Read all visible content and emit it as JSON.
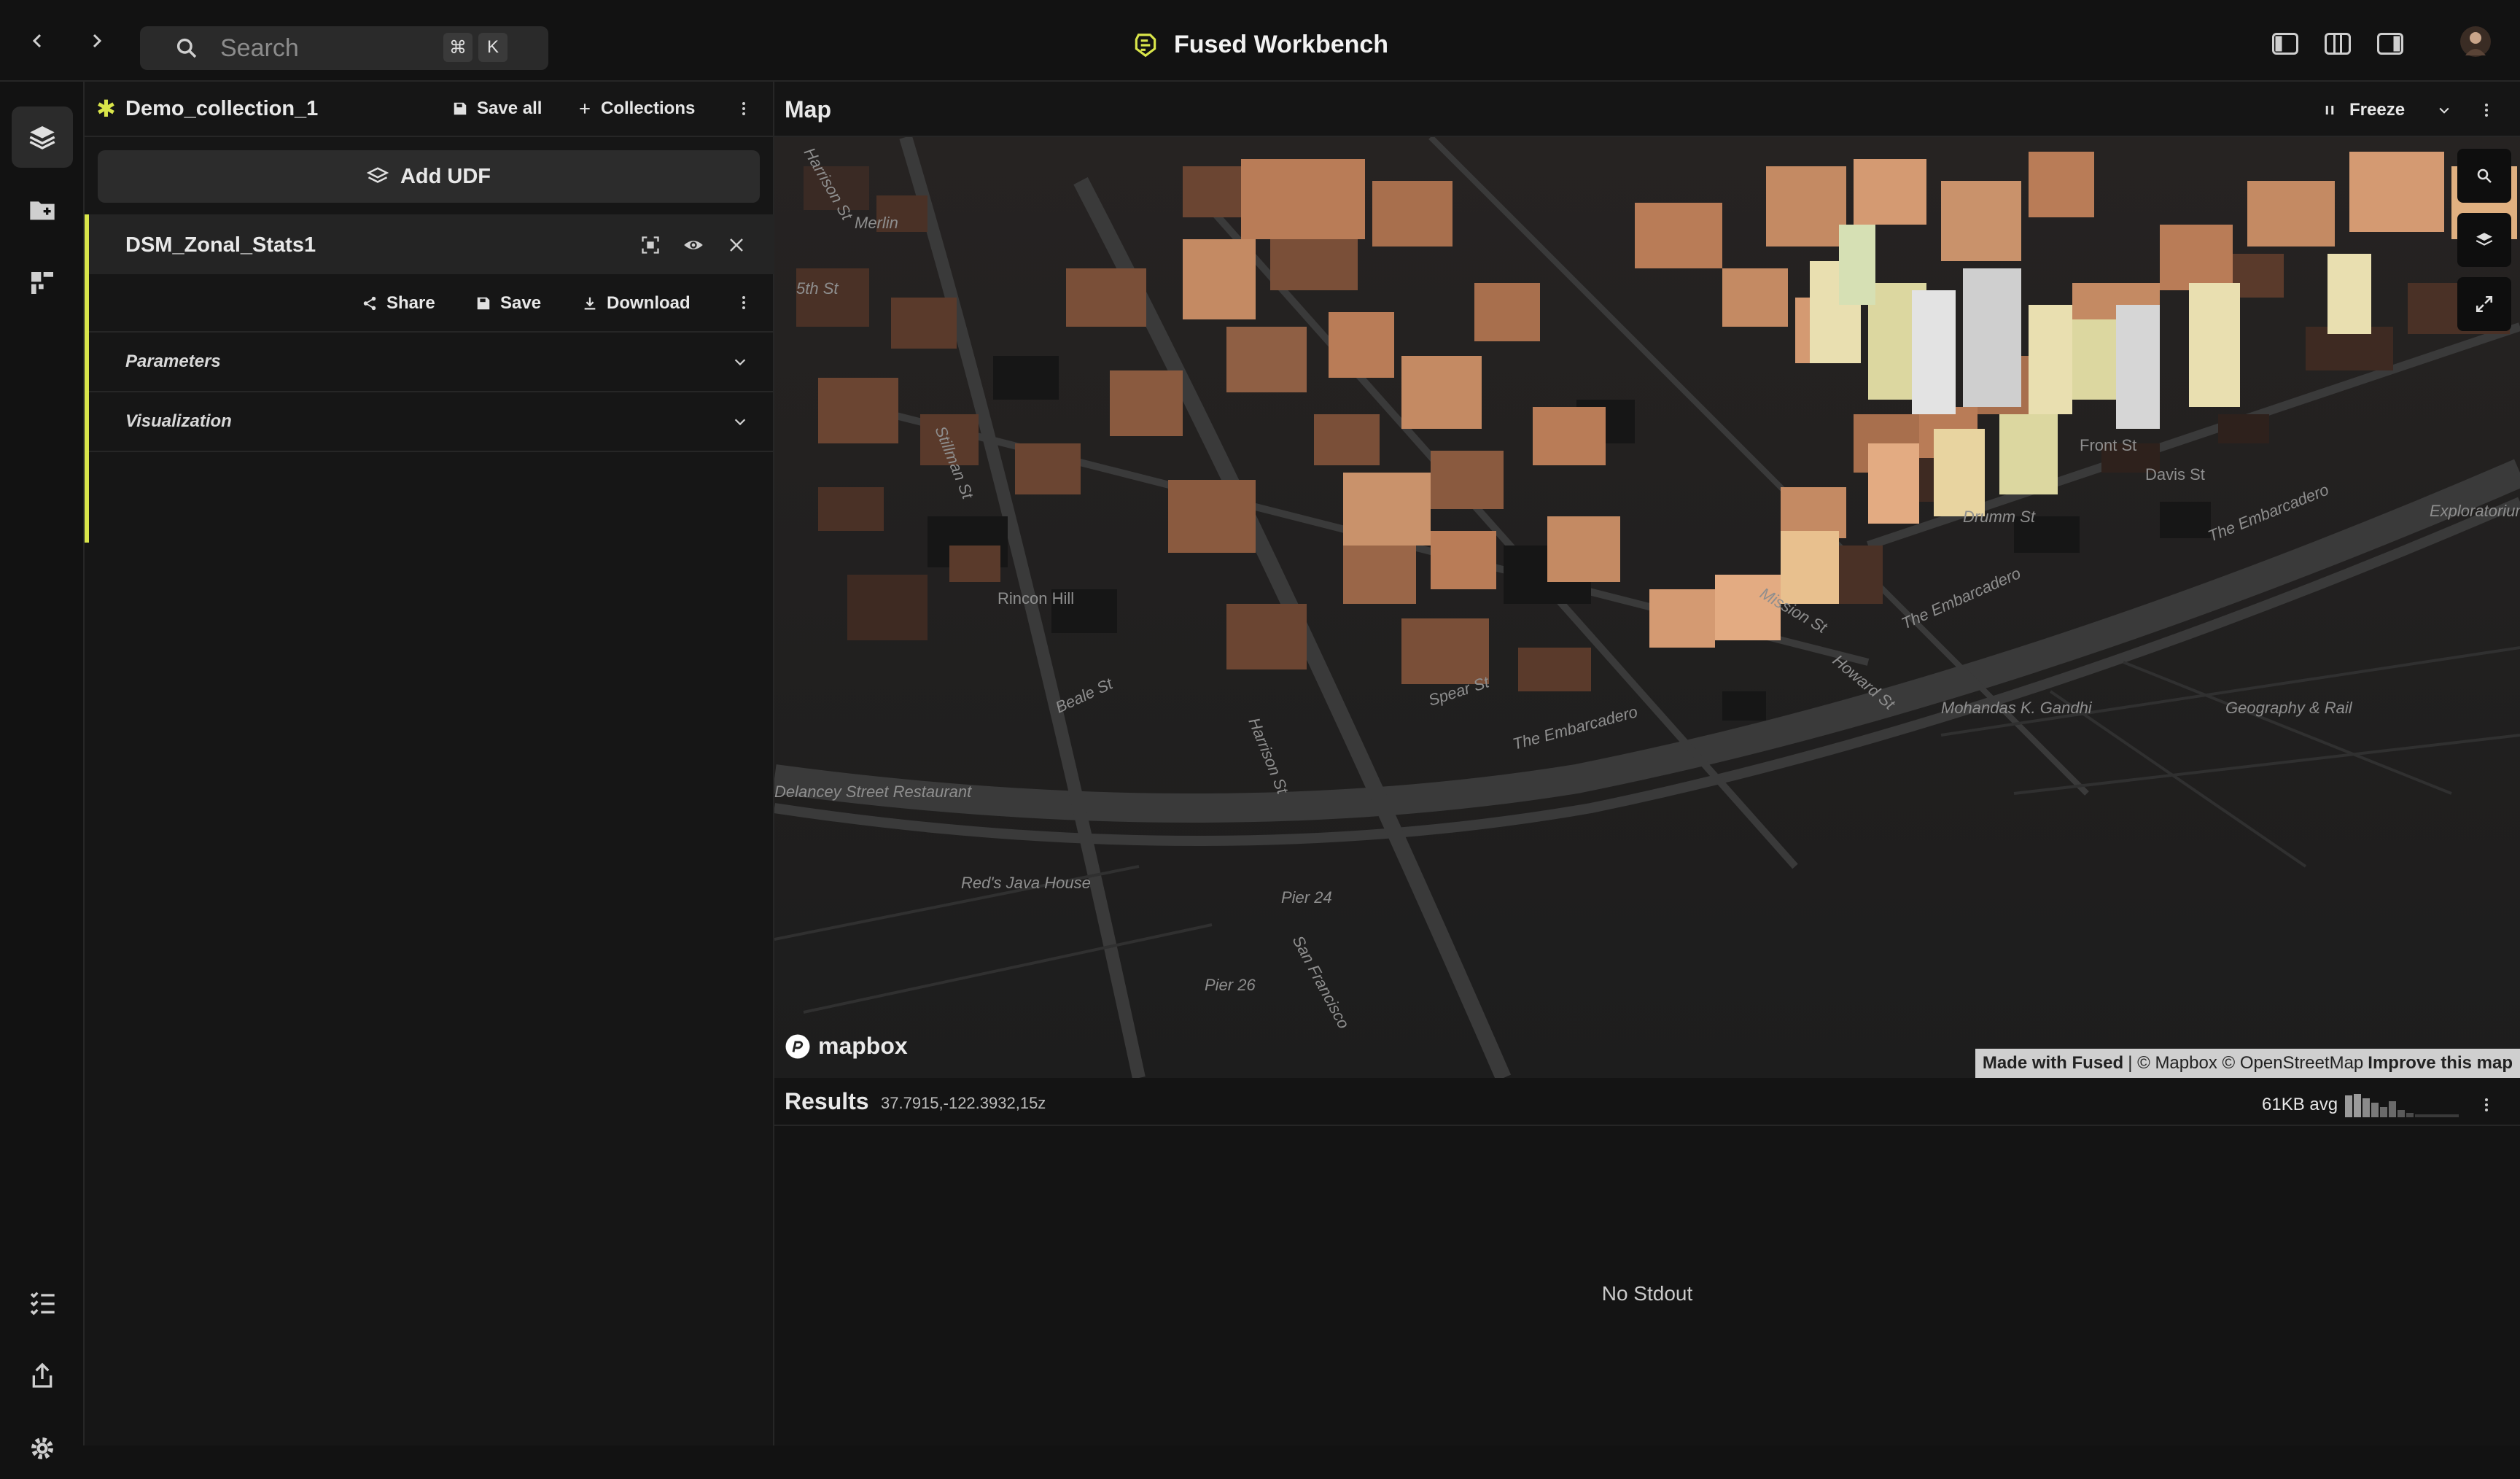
{
  "topbar": {
    "search_placeholder": "Search",
    "shortcut_cmd": "⌘",
    "shortcut_key": "K",
    "app_title": "Fused Workbench"
  },
  "sidebar": {
    "collection_name": "Demo_collection_1",
    "save_all": "Save all",
    "collections": "Collections",
    "add_udf": "Add UDF",
    "udf": {
      "name": "DSM_Zonal_Stats1",
      "share": "Share",
      "save": "Save",
      "download": "Download",
      "sections": [
        "Parameters",
        "Visualization"
      ]
    }
  },
  "map": {
    "title": "Map",
    "freeze": "Freeze",
    "mapbox": "mapbox",
    "attribution_made": "Made with Fused",
    "attribution_rest": "| © Mapbox © OpenStreetMap",
    "attribution_improve": "Improve this map",
    "street_labels": [
      "Harrison St",
      "Merlin",
      "5th St",
      "Stillman St",
      "Rincon Hill",
      "Beale St",
      "Harrison St",
      "Spear St",
      "The Embarcadero",
      "The Embarcadero",
      "The Embarcadero",
      "Howard St",
      "Mission St",
      "Davis St",
      "Front St",
      "Mohandas K. Gandhi",
      "Geography & Rail",
      "Exploratorium",
      "Red's Java House",
      "Pier 24",
      "Pier 26",
      "San Francisco",
      "Delancey Street Restaurant",
      "Drumm St"
    ]
  },
  "results": {
    "title": "Results",
    "coords": "37.7915,-122.3932,15z",
    "avg": "61KB avg",
    "empty": "No Stdout"
  },
  "colors": {
    "accent": "#d9e54a",
    "background": "#121212",
    "building_dark": "#4a3126",
    "building_mid": "#b97c57",
    "building_light": "#e9dfb0"
  }
}
